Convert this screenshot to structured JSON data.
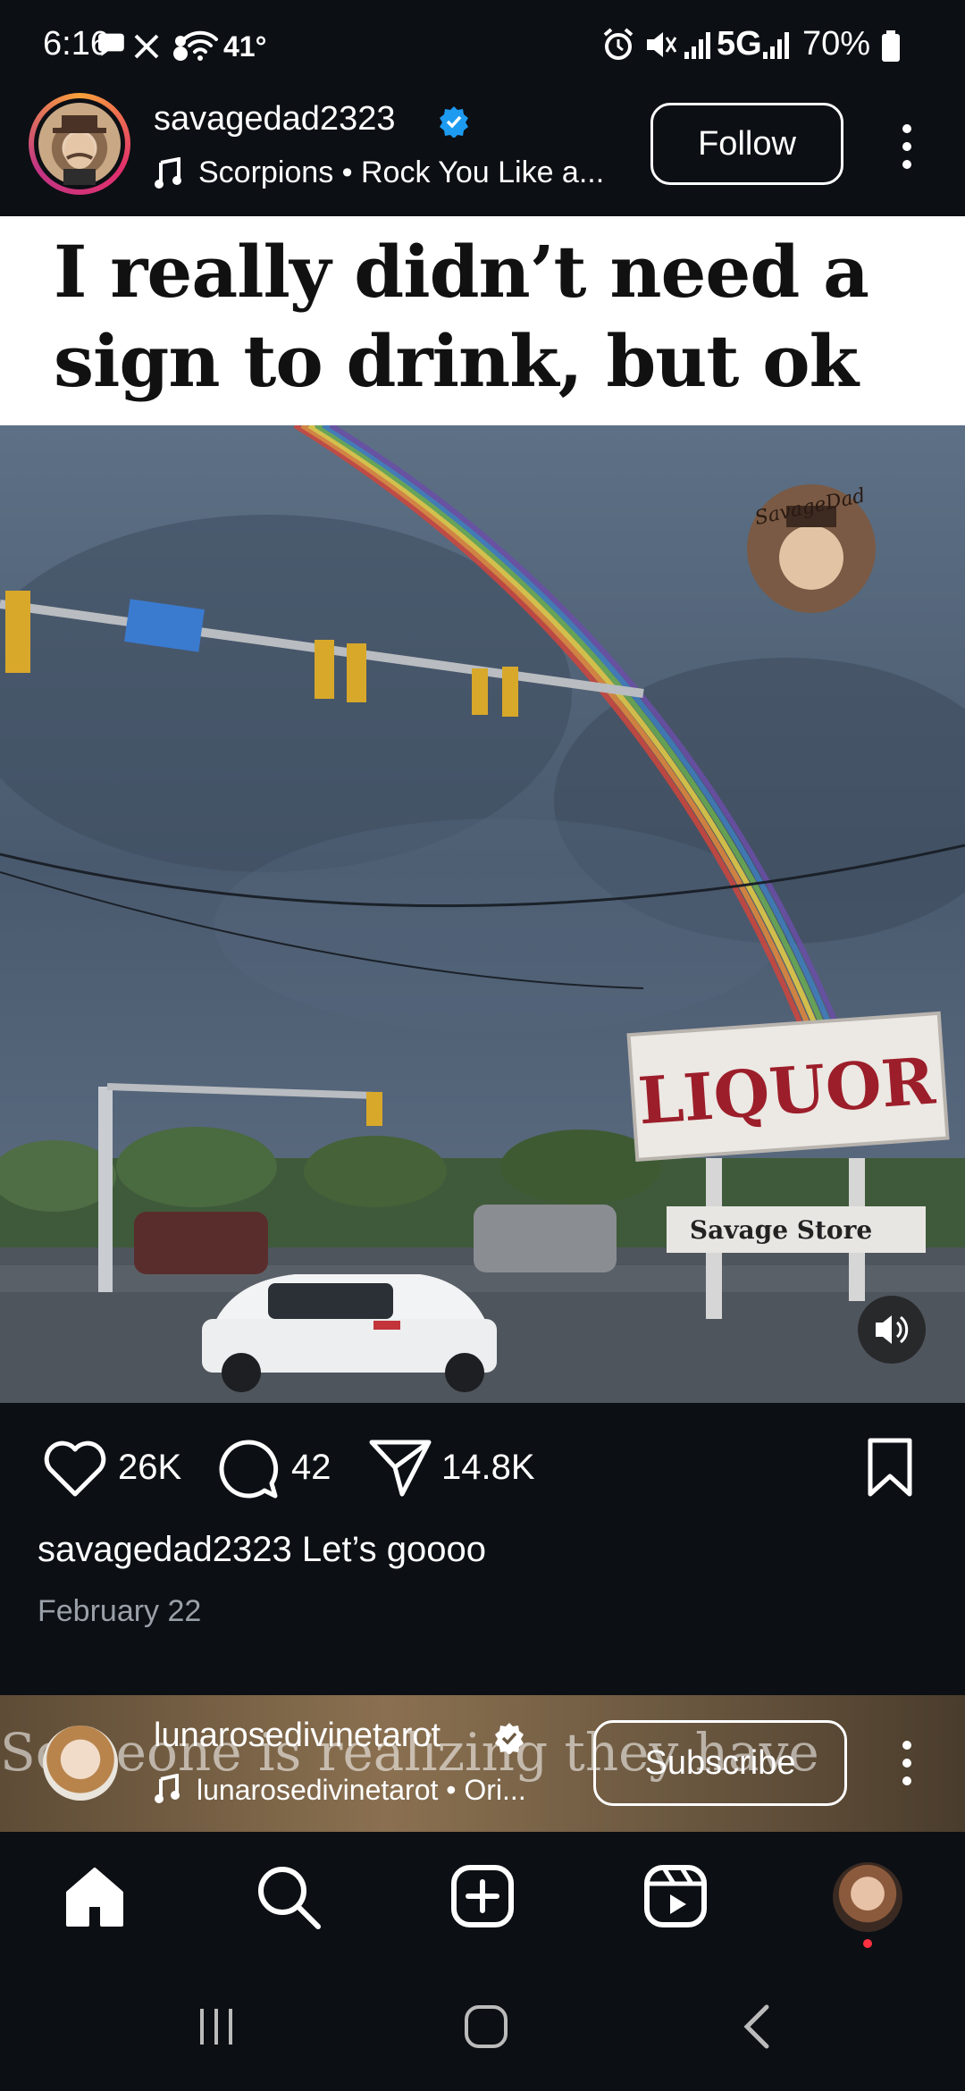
{
  "status_bar": {
    "time": "6:16",
    "temperature": "41°",
    "network": "5G",
    "battery": "70%"
  },
  "post": {
    "username": "savagedad2323",
    "verified": true,
    "audio": "Scorpions • Rock You Like a...",
    "follow_label": "Follow",
    "caption_banner_line1": "I really didn’t need a",
    "caption_banner_line2": "sign to drink, but ok",
    "watermark_text": "SavageDad",
    "sign_main": "LIQUOR",
    "sign_sub": "Savage Store",
    "likes": "26K",
    "comments": "42",
    "shares": "14.8K",
    "caption_user": "savagedad2323",
    "caption_text": "Let’s goooo",
    "date": "February 22"
  },
  "next_post": {
    "username": "lunarosedivinetarot",
    "audio": "lunarosedivinetarot • Ori...",
    "subscribe_label": "Subscribe",
    "overlay_text": "Someone is realizing they have"
  },
  "icons": {
    "home": "home-icon",
    "search": "search-icon",
    "create": "create-icon",
    "reels": "reels-icon",
    "profile": "profile-avatar"
  },
  "colors": {
    "background": "#0c0f14",
    "verified": "#1d9bf0",
    "notification_dot": "#ff3040"
  }
}
